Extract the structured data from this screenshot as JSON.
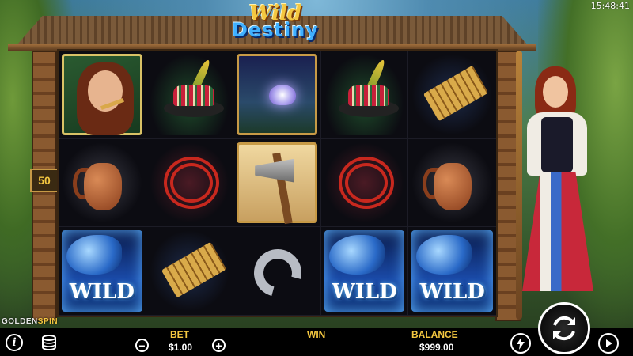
{
  "status": {
    "clock": "15:48:41"
  },
  "game": {
    "logo_line1": "Wild",
    "logo_line2": "Destiny",
    "lines": "50",
    "brand_prefix": "GOLDEN",
    "brand_suffix": "SPIN"
  },
  "reels": {
    "rows": [
      [
        "girl",
        "hat",
        "lotus",
        "hat",
        "pipe"
      ],
      [
        "jug",
        "beads",
        "axe",
        "beads",
        "jug"
      ],
      [
        "wild",
        "pipe",
        "horseshoe",
        "wild",
        "wild"
      ]
    ],
    "wild_label": "WILD"
  },
  "controls": {
    "bet_label": "BET",
    "bet_value": "$1.00",
    "win_label": "WIN",
    "balance_label": "BALANCE",
    "balance_value": "$999.00",
    "info_icon": "i",
    "minus": "−",
    "plus": "+",
    "turbo_icon": "lightning-icon",
    "spin_icon": "spin-arrows-icon",
    "autoplay_icon": "play-icon"
  },
  "colors": {
    "accent": "#f4c740",
    "wild_glow": "#5ab0ff"
  }
}
